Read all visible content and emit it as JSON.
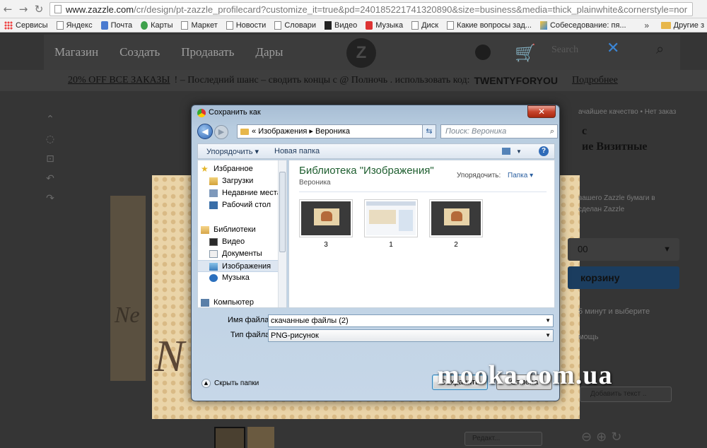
{
  "browser": {
    "url_domain": "www.zazzle.com",
    "url_path": "/cr/design/pt-zazzle_profilecard?customize_it=true&pd=240185221741320890&size=business&media=thick_plainwhite&cornerstyle=nor",
    "back_icon": "arrow-left-icon",
    "forward_icon": "arrow-right-icon",
    "reload_icon": "reload-icon",
    "bookmarks": [
      "Сервисы",
      "Яндекс",
      "Почта",
      "Карты",
      "Маркет",
      "Новости",
      "Словари",
      "Видео",
      "Музыка",
      "Диск",
      "Какие вопросы зад...",
      "Собеседование: пя..."
    ],
    "bookmarks_more": "»",
    "other_bookmarks": "Другие з"
  },
  "site": {
    "nav": [
      "Магазин",
      "Создать",
      "Продавать",
      "Дары"
    ],
    "logo": "Z",
    "search_placeholder": "Search",
    "promo": {
      "discount": "20% OFF ВСЕ ЗАКАЗЫ",
      "mid": "! – Последний шанс – сводить концы с @ Полночь . использовать код:",
      "code": "TWENTYFORYOU",
      "more": "Подробнее"
    },
    "right_top": "ачайшее качество  •  Нет заказ",
    "title_line1": "с",
    "title_line2": "ие Визитные",
    "desc_line1": "вашего Zazzle бумаги в",
    "desc_line2": "сделан Zazzle",
    "qty_value": "00",
    "cart_label": "корзину",
    "ship_line1": "5 минут и выберите",
    "help_line": "мощь",
    "add_text": "Добавить текст ..",
    "edit_label": "Редакт...",
    "card_script_big": "N  a  e",
    "card_script_small": "Ne"
  },
  "watermark": "mooka.com.ua",
  "dialog": {
    "title": "Сохранить как",
    "close_label": "✕",
    "breadcrumb_prefix": "«",
    "breadcrumb": [
      "Изображения",
      "Вероника"
    ],
    "search_placeholder": "Поиск: Вероника",
    "organize_label": "Упорядочить ▾",
    "new_folder_label": "Новая папка",
    "help_label": "?",
    "nav_items": [
      {
        "label": "Избранное",
        "icon": "star-icon",
        "indent": 0
      },
      {
        "label": "Загрузки",
        "icon": "downloads-folder-icon",
        "indent": 1
      },
      {
        "label": "Недавние места",
        "icon": "recent-places-icon",
        "indent": 1
      },
      {
        "label": "Рабочий стол",
        "icon": "desktop-icon",
        "indent": 1
      },
      {
        "label": "Библиотеки",
        "icon": "libraries-icon",
        "indent": 0
      },
      {
        "label": "Видео",
        "icon": "video-library-icon",
        "indent": 1
      },
      {
        "label": "Документы",
        "icon": "documents-library-icon",
        "indent": 1
      },
      {
        "label": "Изображения",
        "icon": "pictures-library-icon",
        "indent": 1,
        "selected": true
      },
      {
        "label": "Музыка",
        "icon": "music-library-icon",
        "indent": 1
      },
      {
        "label": "Компьютер",
        "icon": "computer-icon",
        "indent": 0
      }
    ],
    "library_title": "Библиотека \"Изображения\"",
    "library_sub": "Вероника",
    "arrange_label": "Упорядочить:",
    "arrange_value": "Папка ▾",
    "files": [
      "3",
      "1",
      "2"
    ],
    "filename_label": "Имя файла:",
    "filename_value": "скачанные файлы (2)",
    "filetype_label": "Тип файла:",
    "filetype_value": "PNG-рисунок",
    "hide_folders_label": "Скрыть папки",
    "save_label": "Сохранить",
    "cancel_label": "Отмена"
  }
}
